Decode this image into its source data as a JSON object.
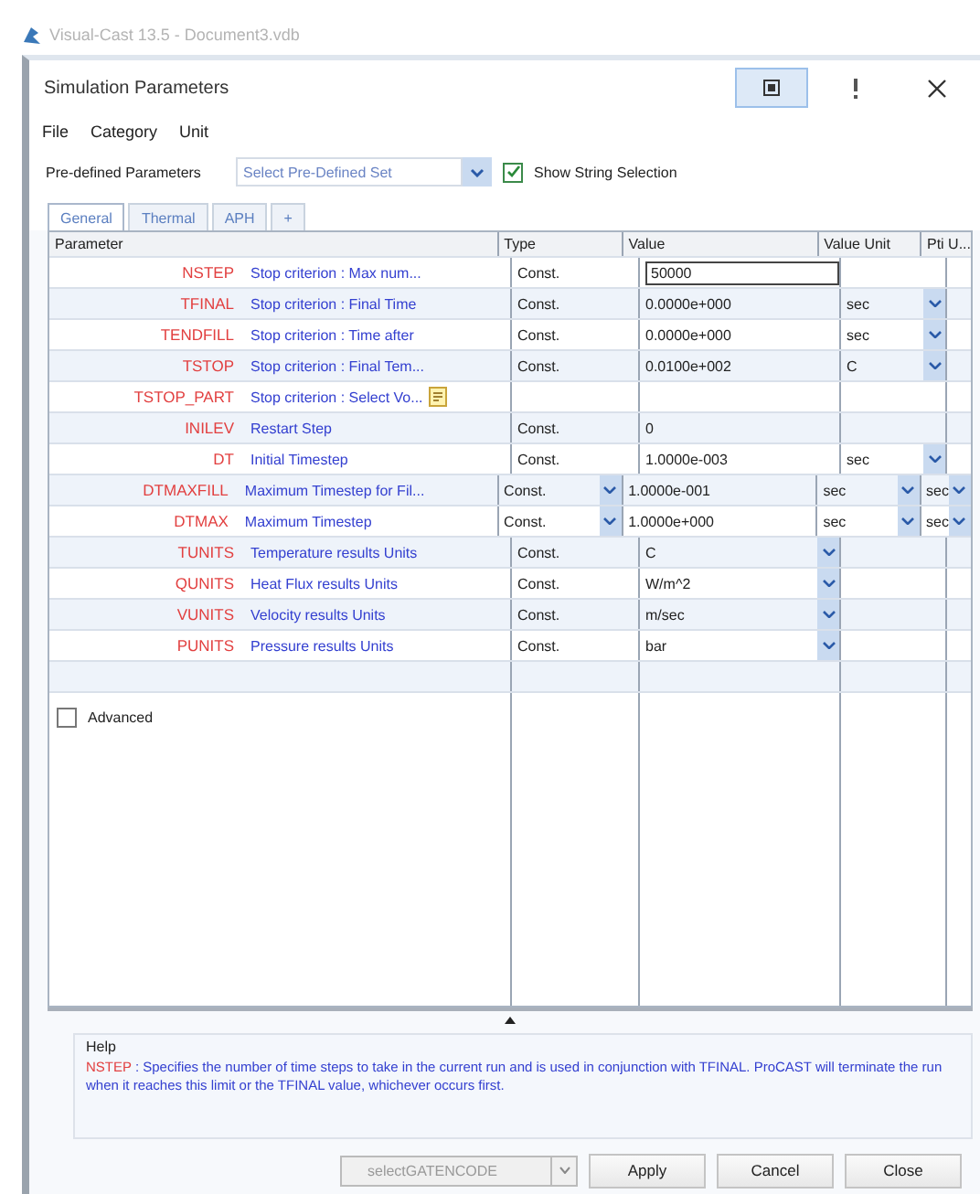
{
  "app": {
    "title": "Visual-Cast 13.5 - Document3.vdb"
  },
  "dialog": {
    "title": "Simulation Parameters"
  },
  "menu": [
    "File",
    "Category",
    "Unit"
  ],
  "predefined": {
    "label": "Pre-defined Parameters",
    "placeholder": "Select Pre-Defined Set",
    "show_string": {
      "label": "Show String Selection",
      "checked": true
    }
  },
  "tabs": [
    {
      "label": "General",
      "selected": true
    },
    {
      "label": "Thermal",
      "selected": false
    },
    {
      "label": "APH",
      "selected": false
    },
    {
      "label": "+",
      "selected": false
    }
  ],
  "table": {
    "columns": [
      "Parameter",
      "Type",
      "Value",
      "Value Unit",
      "Pti U..."
    ],
    "rows": [
      {
        "name": "NSTEP",
        "desc": "Stop criterion : Max num...",
        "type": {
          "text": "Const."
        },
        "value": {
          "text": "50000",
          "kind": "edit"
        }
      },
      {
        "name": "TFINAL",
        "desc": "Stop criterion : Final Time",
        "type": {
          "text": "Const."
        },
        "value": {
          "text": "0.0000e+000",
          "kind": "plain"
        },
        "unit": {
          "text": "sec",
          "dropdown": true
        }
      },
      {
        "name": "TENDFILL",
        "desc": "Stop criterion : Time after",
        "type": {
          "text": "Const."
        },
        "value": {
          "text": "0.0000e+000",
          "kind": "plain"
        },
        "unit": {
          "text": "sec",
          "dropdown": true
        }
      },
      {
        "name": "TSTOP",
        "desc": "Stop criterion : Final Tem...",
        "type": {
          "text": "Const."
        },
        "value": {
          "text": "0.0100e+002",
          "kind": "plain"
        },
        "unit": {
          "text": "C",
          "dropdown": true
        }
      },
      {
        "name": "TSTOP_PART",
        "desc": "Stop criterion : Select Vo...",
        "picker": true
      },
      {
        "name": "INILEV",
        "desc": "Restart Step",
        "type": {
          "text": "Const."
        },
        "value": {
          "text": "0",
          "kind": "plain"
        }
      },
      {
        "name": "DT",
        "desc": "Initial Timestep",
        "type": {
          "text": "Const."
        },
        "value": {
          "text": "1.0000e-003",
          "kind": "plain"
        },
        "unit": {
          "text": "sec",
          "dropdown": true
        }
      },
      {
        "name": "DTMAXFILL",
        "desc": "Maximum Timestep for Fil...",
        "type": {
          "text": "Const.",
          "dropdown": true
        },
        "value": {
          "text": "1.0000e-001",
          "kind": "plain"
        },
        "unit": {
          "text": "sec",
          "dropdown": true
        },
        "pti": {
          "text": "sec",
          "dropdown": true
        }
      },
      {
        "name": "DTMAX",
        "desc": "Maximum Timestep",
        "type": {
          "text": "Const.",
          "dropdown": true
        },
        "value": {
          "text": "1.0000e+000",
          "kind": "plain"
        },
        "unit": {
          "text": "sec",
          "dropdown": true
        },
        "pti": {
          "text": "sec",
          "dropdown": true
        }
      },
      {
        "name": "TUNITS",
        "desc": "Temperature results Units",
        "type": {
          "text": "Const."
        },
        "value": {
          "text": "C",
          "kind": "plain",
          "dropdown": true
        }
      },
      {
        "name": "QUNITS",
        "desc": "Heat Flux results Units",
        "type": {
          "text": "Const."
        },
        "value": {
          "text": "W/m^2",
          "kind": "plain",
          "dropdown": true
        }
      },
      {
        "name": "VUNITS",
        "desc": "Velocity results Units",
        "type": {
          "text": "Const."
        },
        "value": {
          "text": "m/sec",
          "kind": "plain",
          "dropdown": true
        }
      },
      {
        "name": "PUNITS",
        "desc": "Pressure results Units",
        "type": {
          "text": "Const."
        },
        "value": {
          "text": "bar",
          "kind": "plain",
          "dropdown": true
        }
      }
    ]
  },
  "advanced": {
    "label": "Advanced",
    "checked": false
  },
  "help": {
    "title": "Help",
    "keyword": "NSTEP",
    "text": ": Specifies the number of time steps to take in the current run and is used in conjunction with TFINAL. ProCAST will terminate the run when it reaches this limit or the TFINAL value, whichever occurs first."
  },
  "footer": {
    "gate_select": {
      "placeholder": "selectGATENCODE",
      "disabled": true
    },
    "buttons": [
      "Apply",
      "Cancel",
      "Close"
    ]
  }
}
